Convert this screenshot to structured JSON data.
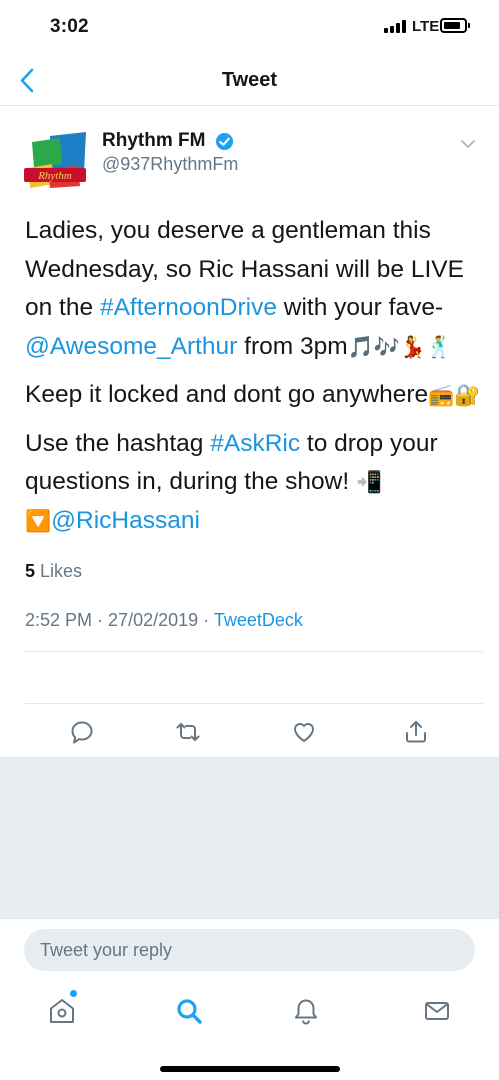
{
  "status": {
    "time": "3:02",
    "network": "LTE"
  },
  "nav": {
    "title": "Tweet"
  },
  "author": {
    "name": "Rhythm FM",
    "handle": "@937RhythmFm",
    "logo_text": "Rhythm",
    "verified": true
  },
  "tweet": {
    "p1_a": "Ladies, you deserve a gentleman this Wednesday, so Ric Hassani will be LIVE on the ",
    "p1_hashtag": "#AfternoonDrive",
    "p1_b": "  with your fave-",
    "p1_mention": "@Awesome_Arthur",
    "p1_c": " from 3pm",
    "p1_emoji": "🎵🎶💃🕺",
    "p2_a": "Keep it locked and dont go anywhere",
    "p2_emoji": "📻🔐",
    "p3_a": "Use the hashtag ",
    "p3_hashtag": "#AskRic",
    "p3_b": " to drop your questions in, during the show! ",
    "p3_emoji": "📲",
    "p4_emoji": "🔽",
    "p4_mention": "@RicHassani"
  },
  "meta": {
    "time": "2:52 PM",
    "separator1": " · ",
    "date": "27/02/2019",
    "separator2": " · ",
    "source": "TweetDeck"
  },
  "likes": {
    "count": "5",
    "label": " Likes"
  },
  "actions": [
    "reply-icon",
    "retweet-icon",
    "like-icon",
    "share-icon"
  ],
  "reply": {
    "placeholder": "Tweet your reply"
  },
  "tabs": [
    "home-icon",
    "search-icon",
    "notifications-icon",
    "messages-icon"
  ],
  "colors": {
    "accent": "#1da1f2",
    "link": "#1b95e0",
    "secondary_text": "#657786",
    "gray_bg": "#e6ecf0"
  }
}
